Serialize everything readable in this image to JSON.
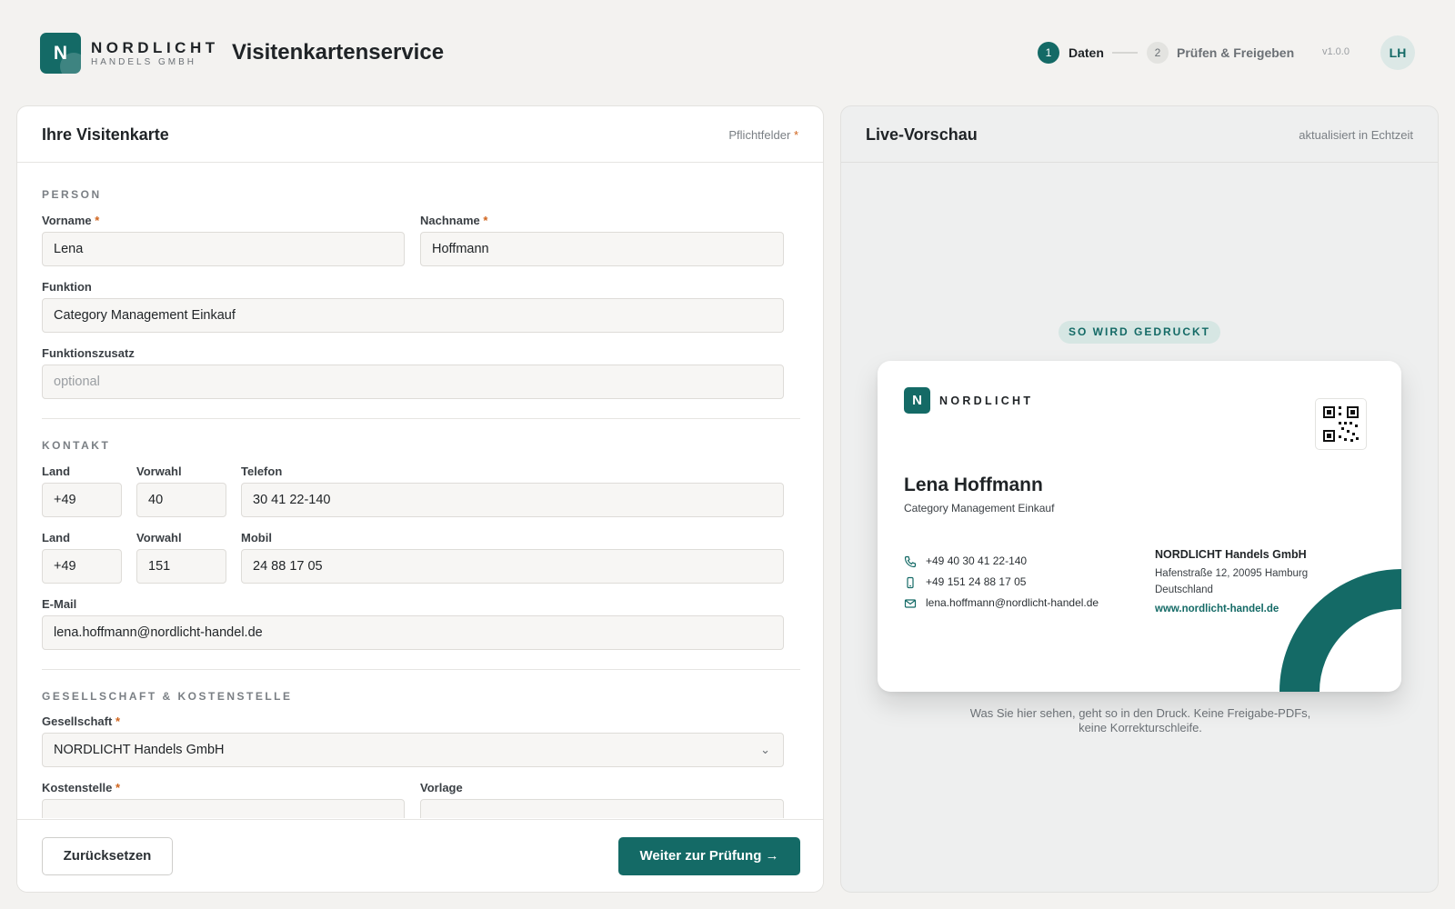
{
  "brand": {
    "logo_letter": "N",
    "name": "NORDLICHT",
    "subtitle": "HANDELS GMBH",
    "color": "#146a66"
  },
  "app_title": "Visitenkartenservice",
  "steps": [
    {
      "number": "1",
      "label": "Daten",
      "active": true
    },
    {
      "number": "2",
      "label": "Prüfen & Freigeben",
      "active": false
    }
  ],
  "version": "v1.0.0",
  "user": {
    "initials": "LH"
  },
  "form": {
    "title": "Ihre Visitenkarte",
    "required_note": "Pflichtfelder",
    "required_mark": "*",
    "sections": {
      "person": "PERSON",
      "contact": "KONTAKT",
      "company": "GESELLSCHAFT & KOSTENSTELLE"
    },
    "fields": {
      "vorname": {
        "label": "Vorname",
        "value": "Lena"
      },
      "nachname": {
        "label": "Nachname",
        "value": "Hoffmann"
      },
      "funktion": {
        "label": "Funktion",
        "value": "Category Management Einkauf"
      },
      "funktionszusatz": {
        "label": "Funktionszusatz",
        "placeholder": "optional"
      },
      "tel_land": {
        "label": "Land",
        "value": "+49"
      },
      "tel_vorwahl": {
        "label": "Vorwahl",
        "value": "40"
      },
      "telefon": {
        "label": "Telefon",
        "value": "30 41 22-140"
      },
      "mob_land": {
        "label": "Land",
        "value": "+49"
      },
      "mob_vorwahl": {
        "label": "Vorwahl",
        "value": "151"
      },
      "mobil": {
        "label": "Mobil",
        "value": "24 88 17 05"
      },
      "email": {
        "label": "E-Mail",
        "value": "lena.hoffmann@nordlicht-handel.de"
      },
      "gesellschaft": {
        "label": "Gesellschaft",
        "value": "NORDLICHT Handels GmbH",
        "arrow": "⌄"
      },
      "kostenstelle": {
        "label": "Kostenstelle",
        "value": ""
      },
      "vorlage": {
        "label": "Vorlage",
        "value": ""
      }
    },
    "reset_label": "Zurücksetzen",
    "next_label": "Weiter zur Prüfung →"
  },
  "preview": {
    "title": "Live-Vorschau",
    "note": "aktualisiert in Echtzeit",
    "badge": "SO WIRD GEDRUCKT",
    "card": {
      "logo_letter": "N",
      "brand": "NORDLICHT",
      "name": "Lena Hoffmann",
      "role": "Category Management Einkauf",
      "phone": "+49 40 30 41 22-140",
      "mobile": "+49 151 24 88 17 05",
      "email": "lena.hoffmann@nordlicht-handel.de",
      "company": "NORDLICHT Handels GmbH",
      "address": "Hafenstraße 12, 20095 Hamburg",
      "country": "Deutschland",
      "website": "www.nordlicht-handel.de"
    },
    "caption": "Was Sie hier sehen, geht so in den Druck. Keine Freigabe-PDFs, keine Korrekturschleife."
  }
}
